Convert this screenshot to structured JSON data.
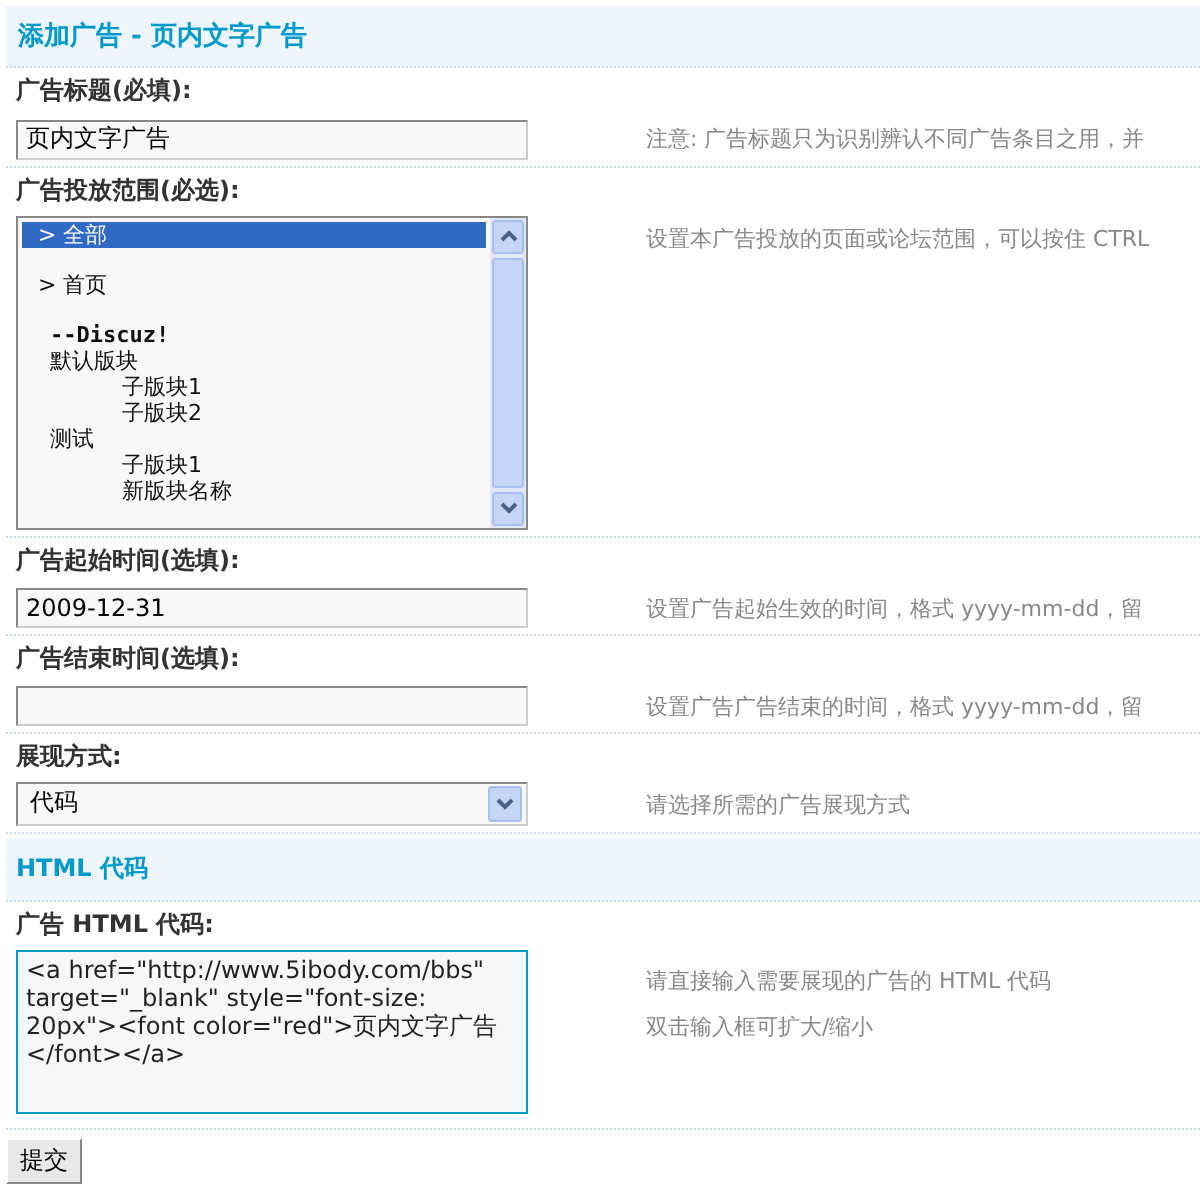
{
  "title": "添加广告 - 页内文字广告",
  "fields": [
    {
      "kind": "text",
      "label": "广告标题(必填):",
      "value": "页内文字广告",
      "help": [
        "注意: 广告标题只为识别辨认不同广告条目之用，并"
      ]
    },
    {
      "kind": "listbox",
      "label": "广告投放范围(必选):",
      "help": [
        "设置本广告投放的页面或论坛范围，可以按住 CTRL"
      ],
      "options": [
        {
          "label": "> 全部",
          "selected": true
        },
        {
          "label": "> 首页",
          "selected": false
        },
        {
          "kind": "group",
          "label": "--Discuz!",
          "children": [
            {
              "label": "默认版块",
              "selected": false,
              "children": [
                {
                  "label": "子版块1",
                  "selected": false
                },
                {
                  "label": "子版块2",
                  "selected": false
                }
              ]
            },
            {
              "label": "测试",
              "selected": false,
              "children": [
                {
                  "label": "子版块1",
                  "selected": false
                },
                {
                  "label": "新版块名称",
                  "selected": false
                }
              ]
            }
          ]
        }
      ]
    },
    {
      "kind": "text",
      "label": "广告起始时间(选填):",
      "value": "2009-12-31",
      "help": [
        "设置广告起始生效的时间，格式 yyyy-mm-dd，留"
      ]
    },
    {
      "kind": "text",
      "label": "广告结束时间(选填):",
      "help": [
        "设置广告广告结束的时间，格式 yyyy-mm-dd，留"
      ]
    },
    {
      "kind": "select",
      "label": "展现方式:",
      "value": "代码",
      "help": [
        "请选择所需的广告展现方式"
      ]
    }
  ],
  "section": "HTML 代码",
  "code_field": {
    "label": "广告 HTML 代码:",
    "value": "<a href=\"http://www.5ibody.com/bbs\" target=\"_blank\" style=\"font-size: 20px\"><font color=\"red\">页内文字广告</font></a>",
    "help": [
      "请直接输入需要展现的广告的 HTML 代码",
      "双击输入框可扩大/缩小"
    ]
  },
  "submit": "提交"
}
